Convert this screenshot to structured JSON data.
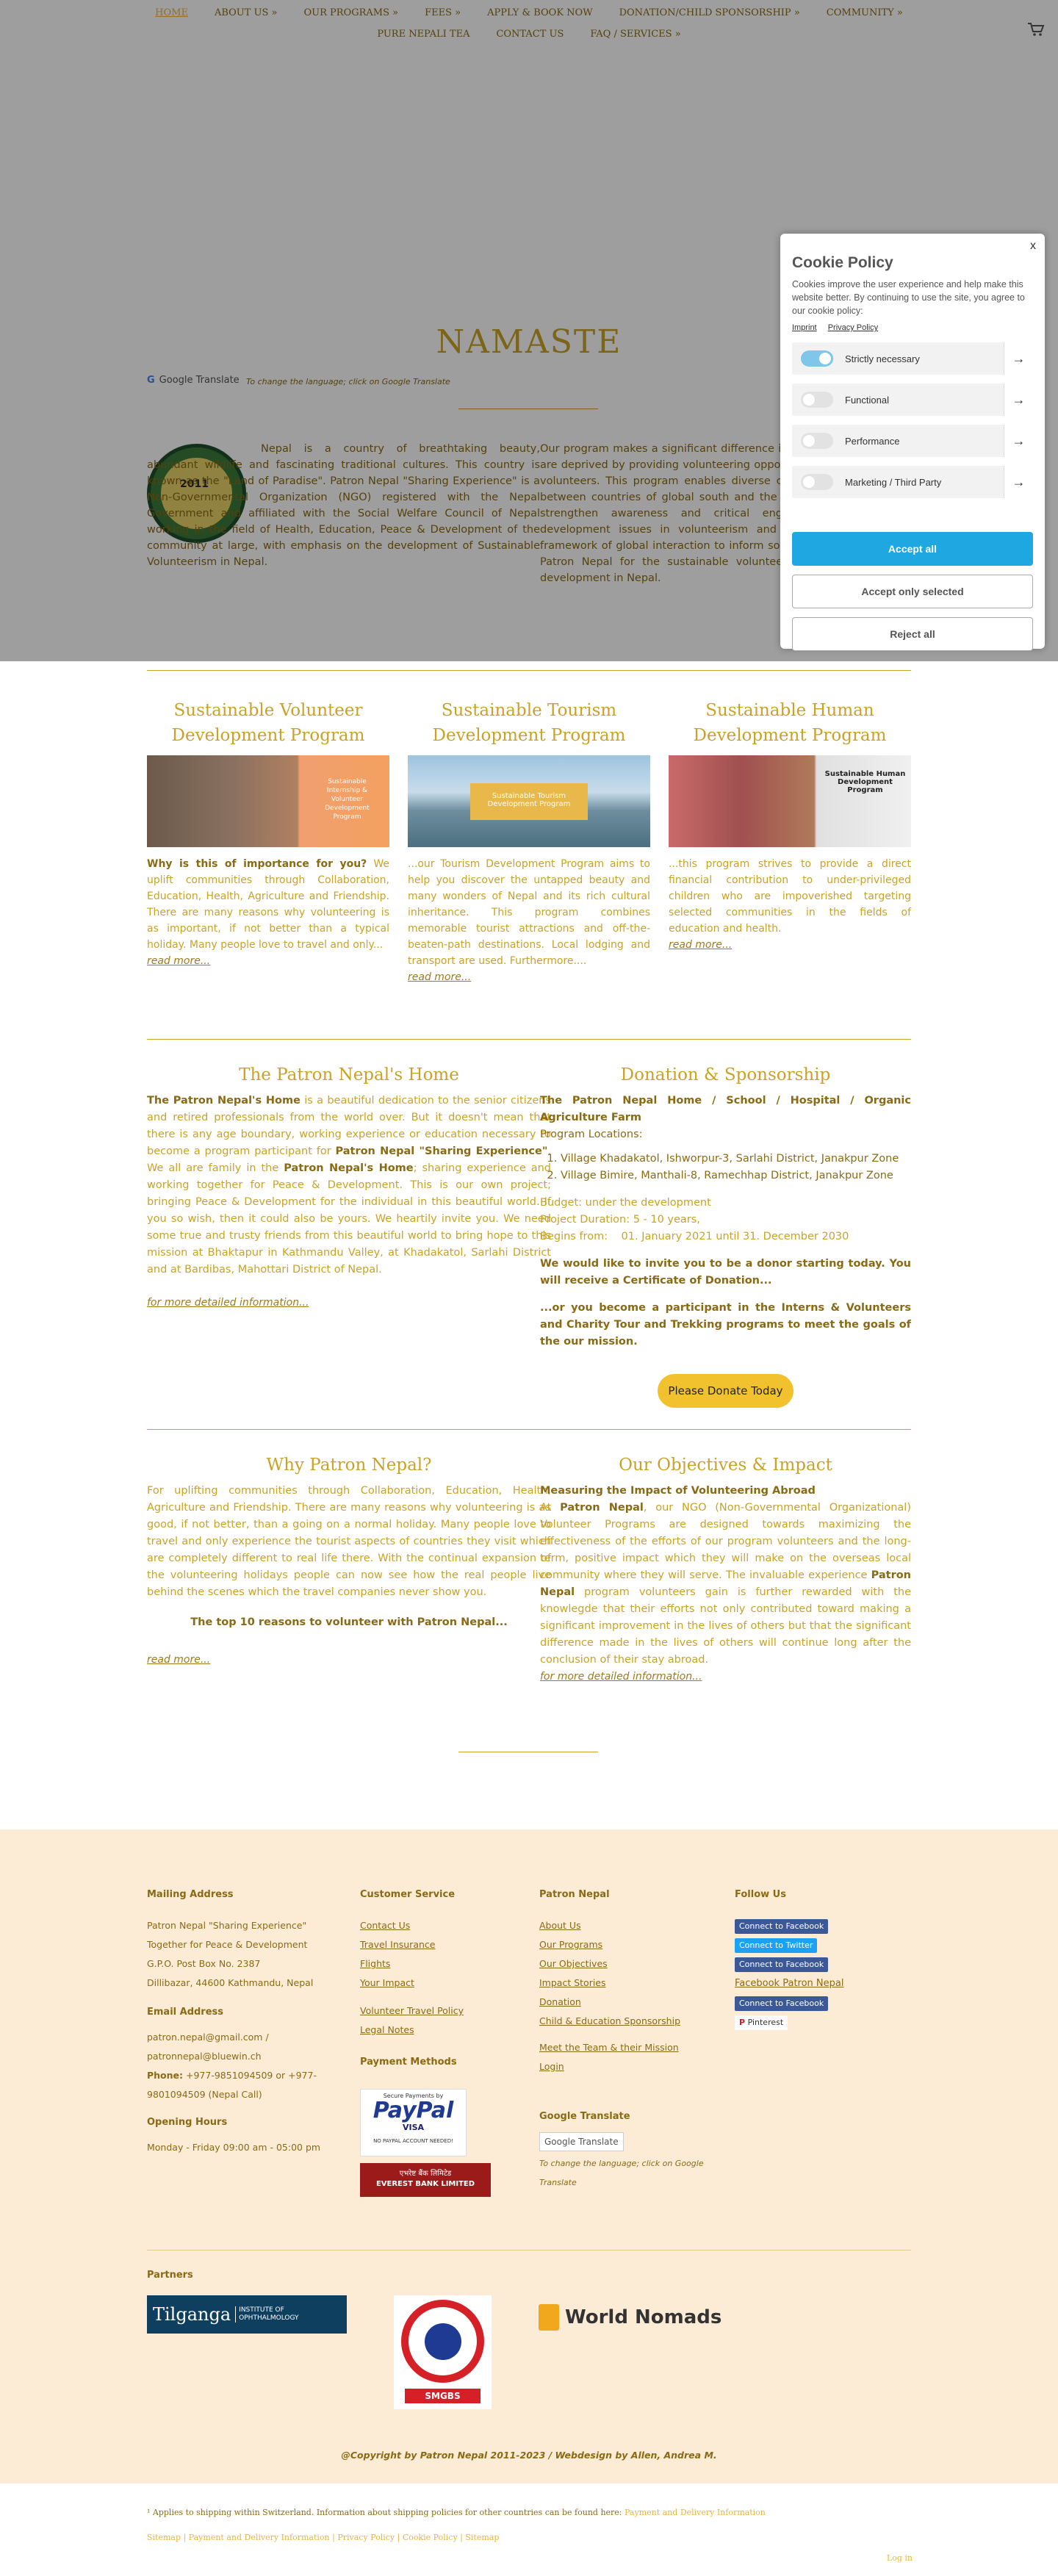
{
  "nav": {
    "row1": [
      "HOME",
      "ABOUT US »",
      "OUR PROGRAMS »",
      "FEES »",
      "APPLY & BOOK NOW",
      "DONATION/CHILD SPONSORSHIP »",
      "COMMUNITY »"
    ],
    "row2": [
      "PURE NEPALI TEA",
      "CONTACT US",
      "FAQ / SERVICES »"
    ]
  },
  "hero": {
    "title": "NAMASTE",
    "google_translate": "Google Translate",
    "translate_hint": "To change the language; click on Google Translate",
    "logo_year": "2011",
    "intro_left": "Nepal is a country of breathtaking beauty, abundant wildlife and fascinating traditional cultures. This country is known as the \"Land of Paradise\". Patron Nepal \"Sharing Experience\" is a Non-Governmental Organization (NGO) registered with the Nepal Government and affiliated with the Social Welfare Council of Nepal working in the field of Health, Education, Peace & Development of the community at large, with emphasis on the development of Sustainable Volunteerism in Nepal.",
    "intro_right": "Our program makes a significant difference in the lives of those who are deprived by providing volunteering opportunities to international volunteers. This program enables diverse cross-cultural exchanges between countries of global south and the west. Our mission is to strengthen awareness and critical engagement with global development issues in volunteerism and to establish a lasting framework of global interaction to inform society of the value of the Patron Nepal for the sustainable volunteer, tourism and human development in Nepal."
  },
  "programs": [
    {
      "title": "Sustainable Volunteer Development Program",
      "lead": "Why is this of importance for you?",
      "body": " We uplift communities through Collaboration, Education, Health, Agriculture and Friendship. There are many reasons why volunteering is as important, if not better than a typical holiday. Many people love to travel and only...",
      "more": "read more...",
      "img_label": "Sustainable Internship & Volunteer Development Program"
    },
    {
      "title": "Sustainable Tourism Development Program",
      "lead": "",
      "body": "...our Tourism Development Program aims to help you discover the untapped beauty and many wonders of Nepal and its rich cultural inheritance. This program combines memorable tourist attractions and off-the-beaten-path destinations. Local lodging and transport are used. Furthermore....",
      "more": "read more...",
      "img_label": "Sustainable Tourism Development Program"
    },
    {
      "title": "Sustainable Human Development Program",
      "lead": "",
      "body": "...this program strives to provide a direct financial contribution to under-privileged children who are impoverished targeting selected communities in the fields of education and health.",
      "more": "read more...",
      "img_label": "Sustainable Human Development Program"
    }
  ],
  "home_section": {
    "title": "The Patron Nepal's Home",
    "p1_b": "The Patron Nepal's Home",
    "p1": " is a beautiful dedication to the senior citizens and retired professionals from the world over. But it doesn't mean that there is any age boundary, working experience or education necessary to become a program participant for ",
    "p1_b2": "Patron Nepal \"Sharing Experience\"",
    "p1b": ". We all are family in the ",
    "p1_b3": "Patron Nepal's Home",
    "p1c": "; sharing experience and working together for Peace & Development. This is our own project; bringing Peace & Development for the individual in this beautiful world. If you so wish, then it could also be yours. We heartily invite you. We need some true and trusty friends from this beautiful world to bring hope to this mission at Bhaktapur in Kathmandu Valley, at Khadakatol, Sarlahi District and at Bardibas, Mahottari District of Nepal.",
    "more": "for more detailed information..."
  },
  "donation": {
    "title": "Donation & Sponsorship",
    "head": "The Patron Nepal Home / School / Hospital / Organic Agriculture Farm",
    "locations_label": "Program Locations:",
    "locations": [
      "Village Khadakatol, Ishworpur-3, Sarlahi District, Janakpur Zone",
      "Village Bimire, Manthali-8, Ramechhap District, Janakpur Zone"
    ],
    "budget": "Budget: under the development",
    "duration": "Project Duration: 5 - 10 years,",
    "begins": "Begins from:    01. January 2021 until 31. December 2030",
    "invite": "We would like to invite you to be a donor starting today. You will receive a Certificate of Donation...",
    "or": "...or you become a participant in the Interns & Volunteers and Charity Tour and Trekking programs to meet the goals of the our mission.",
    "button": "Please Donate Today"
  },
  "why": {
    "title": "Why Patron Nepal?",
    "body": "For uplifting communities through Collaboration, Education, Health, Agriculture and Friendship. There are many reasons why volunteering is as good, if not better, than a going on a normal holiday. Many people love to travel and only experience the tourist aspects of countries they visit which are completely different to real life there. With the continual expansion of the volunteering holidays people can now see how the real people live behind the scenes which the travel companies never show you.",
    "top10": "The top 10 reasons to volunteer with Patron Nepal...",
    "more": "read more..."
  },
  "objectives": {
    "title": "Our Objectives & Impact",
    "lead": "Measuring the Impact of Volunteering Abroad",
    "p1a": "At ",
    "p1b": "Patron Nepal",
    "p1c": ", our NGO (Non-Governmental Organizational) Volunteer Programs are designed towards maximizing the effectiveness of the efforts of our program volunteers and the long-term, positive impact which they will make on the overseas local community where they will serve. The invaluable experience ",
    "p1d": "Patron Nepal",
    "p1e": " program volunteers gain is further rewarded with the knowlegde that their efforts not only contributed toward making a significant improvement in the lives of others but that the significant difference made in the lives of others will continue long after the conclusion of their stay abroad.",
    "more": "for more detailed information..."
  },
  "footer": {
    "mailing": {
      "title": "Mailing Address",
      "lines": [
        "Patron Nepal \"Sharing Experience\"",
        "Together for Peace & Development",
        "G.P.O. Post Box No. 2387",
        "Dillibazar, 44600 Kathmandu, Nepal"
      ]
    },
    "email": {
      "title": "Email Address",
      "lines": [
        "patron.nepal@gmail.com /",
        "patronnepal@bluewin.ch"
      ],
      "phone_label": "Phone:",
      "phone": " +977-9851094509 or +977-9801094509 (Nepal Call)"
    },
    "hours": {
      "title": "Opening Hours",
      "line": "Monday - Friday 09:00 am - 05:00 pm"
    },
    "service": {
      "title": "Customer Service",
      "links": [
        "Contact Us",
        "Travel Insurance",
        "Flights",
        "Your Impact"
      ],
      "links2": [
        "Volunteer Travel Policy",
        "Legal Notes"
      ]
    },
    "payment": {
      "title": "Payment Methods",
      "paypal_top": "Secure Payments by",
      "paypal": "PayPal",
      "paypal_note": "NO PAYPAL ACCOUNT NEEDED!",
      "visa": "VISA",
      "bank_np": "एभरेष्ट बैंक लिमिटेड",
      "bank": "EVEREST BANK LIMITED"
    },
    "patron": {
      "title": "Patron Nepal",
      "links": [
        "About Us",
        "Our Programs",
        "Our Objectives",
        "Impact Stories",
        "Donation",
        "Child & Education Sponsorship"
      ],
      "links2": [
        "Meet the Team & their Mission",
        "Login"
      ]
    },
    "gt": {
      "title": "Google Translate",
      "button": "Google Translate",
      "hint": "To change the language; click on Google Translate"
    },
    "follow": {
      "title": "Follow Us",
      "fb1": "Connect to Facebook",
      "tw": "Connect to Twitter",
      "fb2": "Connect to Facebook",
      "fb_link": "Facebook Patron Nepal",
      "fb3": "Connect to Facebook",
      "pin": "Pinterest"
    },
    "partners": {
      "title": "Partners",
      "tilganga_a": "Tilganga",
      "tilganga_b": "INSTITUTE OF OPHTHALMOLOGY",
      "smgbs": "SMGBS",
      "nomads": "World Nomads"
    },
    "copyright": "@Copyright by Patron Nepal 2011-2023 / Webdesign by Allen, Andrea M.",
    "fine1": "¹ Applies to shipping within Switzerland. Information about shipping policies for other countries can be found here:",
    "fine1_link": "Payment and Delivery Information",
    "fine2": [
      "Sitemap",
      "Payment and Delivery Information",
      "Privacy Policy",
      "Cookie Policy",
      "Sitemap"
    ],
    "login": "Log in"
  },
  "cookie": {
    "close": "x",
    "title": "Cookie Policy",
    "desc": "Cookies improve the user experience and help make this website better. By continuing to use the site, you agree to our cookie policy:",
    "imprint": "Imprint",
    "privacy": "Privacy Policy",
    "options": [
      "Strictly necessary",
      "Functional",
      "Performance",
      "Marketing / Third Party"
    ],
    "accept_all": "Accept all",
    "accept_selected": "Accept only selected",
    "reject_all": "Reject all"
  },
  "colors": {
    "gold": "#c9a227",
    "dark_gold": "#8a6a14",
    "footer_bg": "#fcebd5",
    "accept": "#1ea7e0",
    "donate": "#f2c12e"
  }
}
